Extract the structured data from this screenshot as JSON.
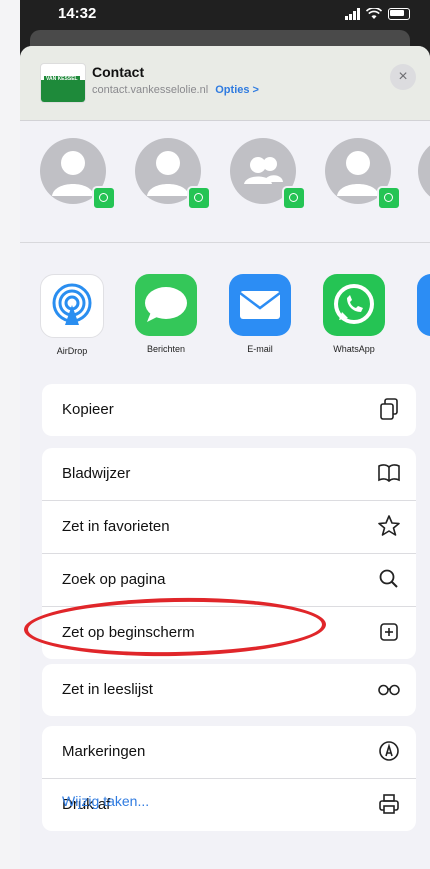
{
  "status_bar": {
    "time": "14:32"
  },
  "share_header": {
    "title": "Contact",
    "url": "contact.vankesselolie.nl",
    "options_label": "Opties >",
    "thumbnail_text": "VAN KESSEL",
    "close_glyph": "×"
  },
  "contacts": [
    {
      "type": "person",
      "badge": "whatsapp"
    },
    {
      "type": "person",
      "badge": "whatsapp"
    },
    {
      "type": "group",
      "badge": "whatsapp"
    },
    {
      "type": "person",
      "badge": "whatsapp"
    },
    {
      "type": "person",
      "badge": "whatsapp"
    }
  ],
  "apps": [
    {
      "label": "AirDrop",
      "icon": "airdrop-icon"
    },
    {
      "label": "Berichten",
      "icon": "messages-icon"
    },
    {
      "label": "E-mail",
      "icon": "mail-icon"
    },
    {
      "label": "WhatsApp",
      "icon": "whatsapp-icon"
    }
  ],
  "action_groups": [
    [
      {
        "label": "Kopieer",
        "icon": "copy-icon"
      }
    ],
    [
      {
        "label": "Bladwijzer",
        "icon": "book-icon"
      },
      {
        "label": "Zet in favorieten",
        "icon": "star-icon"
      },
      {
        "label": "Zoek op pagina",
        "icon": "search-icon"
      },
      {
        "label": "Zet op beginscherm",
        "icon": "add-square-icon"
      }
    ],
    [
      {
        "label": "Zet in leeslijst",
        "icon": "glasses-icon"
      }
    ],
    [
      {
        "label": "Markeringen",
        "icon": "markup-icon"
      },
      {
        "label": "Druk af",
        "icon": "print-icon"
      }
    ]
  ],
  "edit_actions_label": "Wijzig taken...",
  "colors": {
    "accent_blue": "#2f7be0",
    "whatsapp_green": "#25c454",
    "annotation_red": "#e0262a"
  }
}
